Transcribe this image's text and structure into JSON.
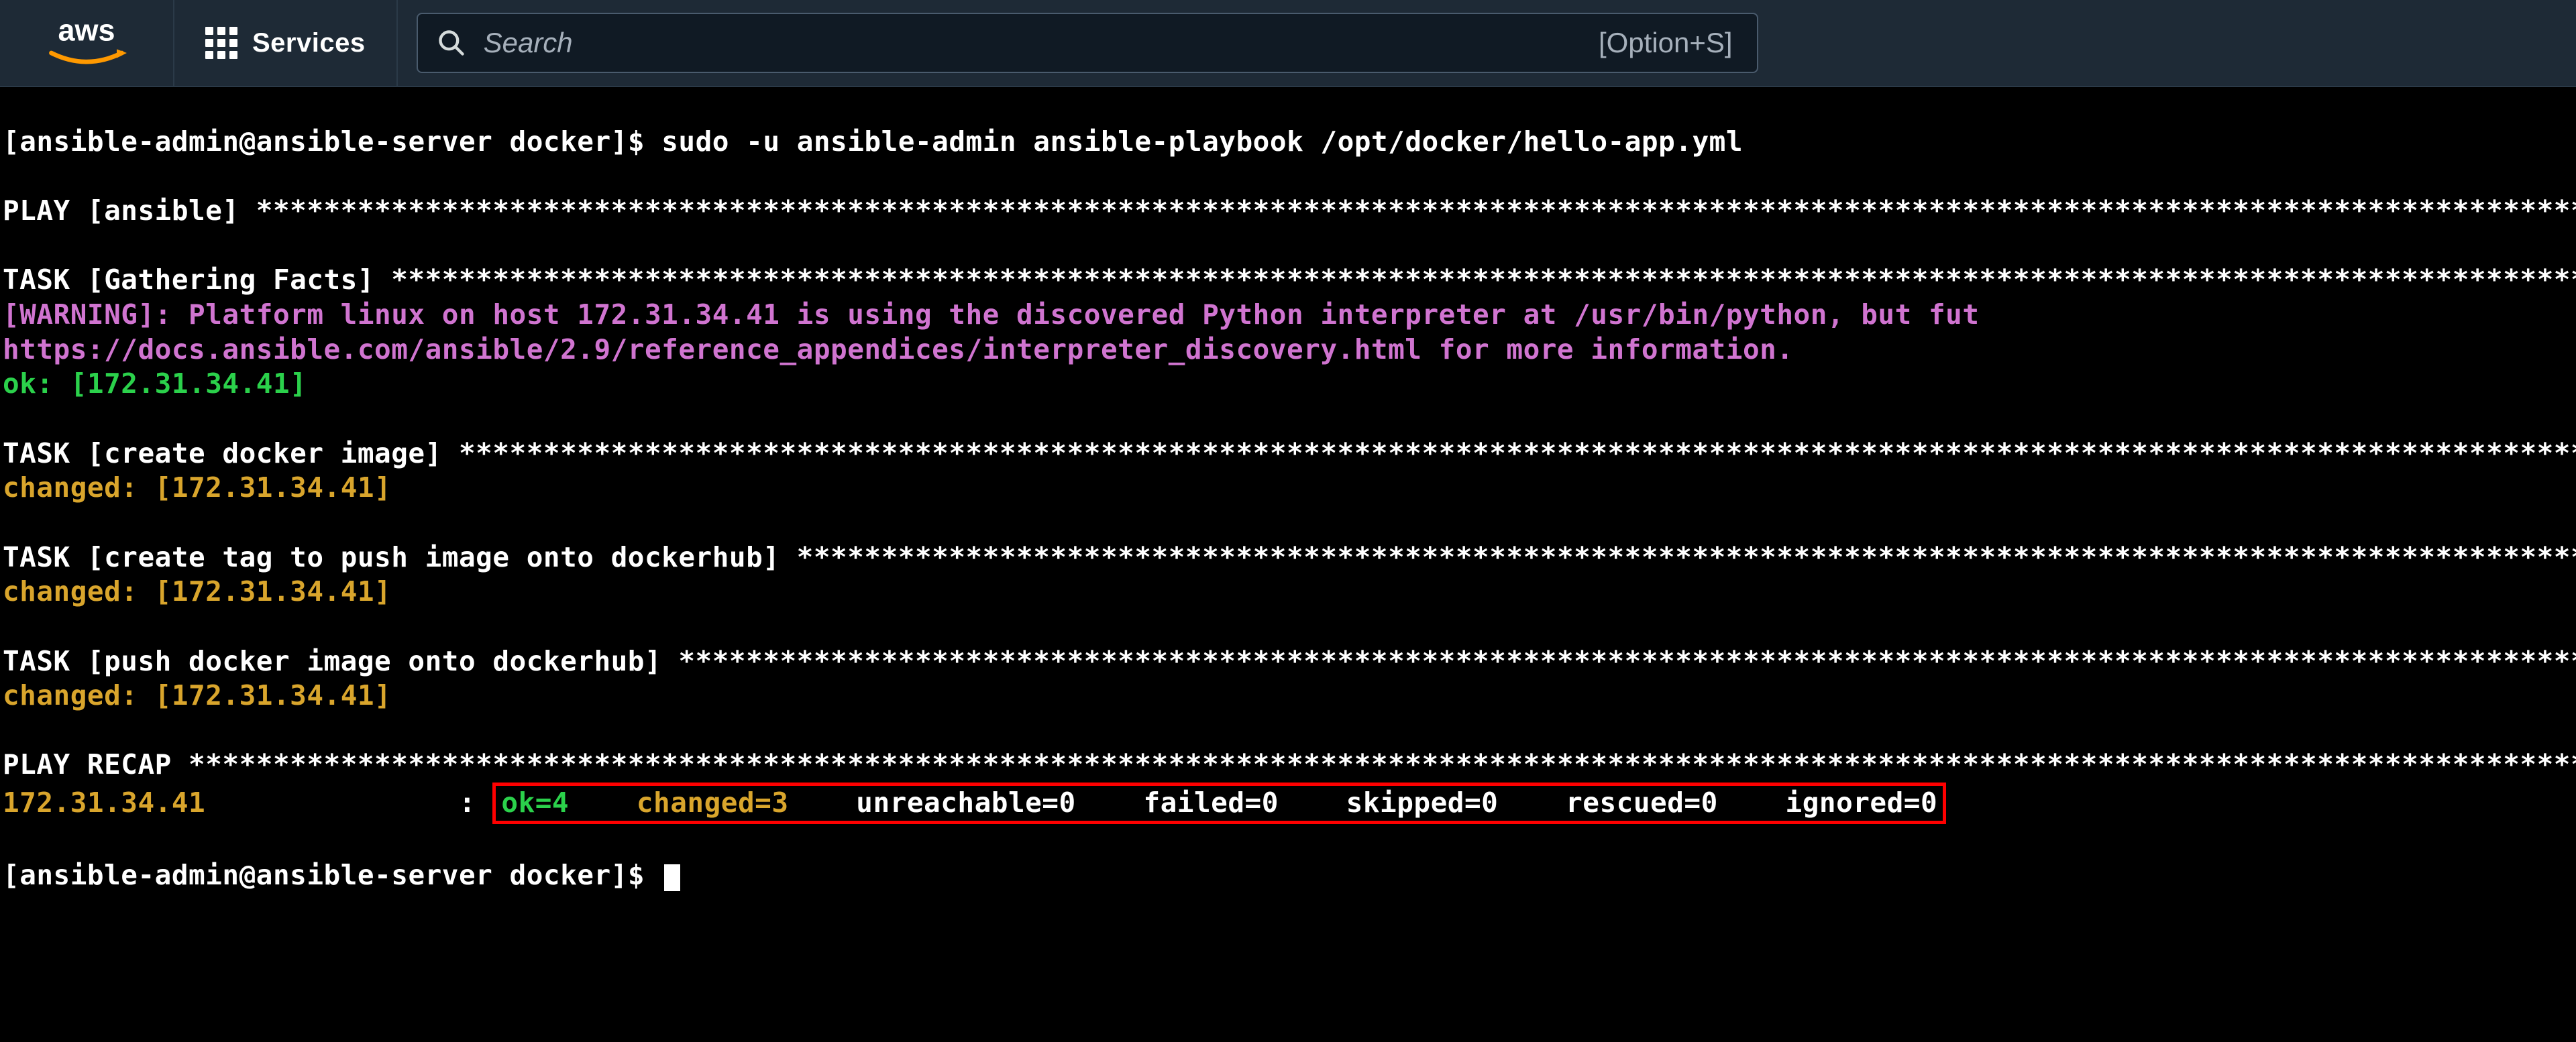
{
  "header": {
    "logo_alt": "aws",
    "services_label": "Services",
    "search_placeholder": "Search",
    "search_shortcut": "[Option+S]"
  },
  "terminal": {
    "prompt_user": "ansible-admin",
    "prompt_host": "ansible-server",
    "prompt_dir": "docker",
    "command": "sudo -u ansible-admin ansible-playbook /opt/docker/hello-app.yml",
    "play_header": "PLAY [ansible] ",
    "tasks": [
      {
        "header": "TASK [Gathering Facts] ",
        "warning_line1": "[WARNING]: Platform linux on host 172.31.34.41 is using the discovered Python interpreter at /usr/bin/python, but fut",
        "warning_line2": "https://docs.ansible.com/ansible/2.9/reference_appendices/interpreter_discovery.html for more information.",
        "status_prefix": "ok: ",
        "status_host": "[172.31.34.41]"
      },
      {
        "header": "TASK [create docker image] ",
        "status_prefix": "changed: ",
        "status_host": "[172.31.34.41]"
      },
      {
        "header": "TASK [create tag to push image onto dockerhub] ",
        "status_prefix": "changed: ",
        "status_host": "[172.31.34.41]"
      },
      {
        "header": "TASK [push docker image onto dockerhub] ",
        "status_prefix": "changed: ",
        "status_host": "[172.31.34.41]"
      }
    ],
    "recap_header": "PLAY RECAP ",
    "recap_host": "172.31.34.41",
    "recap": {
      "ok": "ok=4",
      "changed": "changed=3",
      "unreachable": "unreachable=0",
      "failed": "failed=0",
      "skipped": "skipped=0",
      "rescued": "rescued=0",
      "ignored": "ignored=0"
    },
    "star_fill": "************************************************************************************************************************************************************************"
  }
}
